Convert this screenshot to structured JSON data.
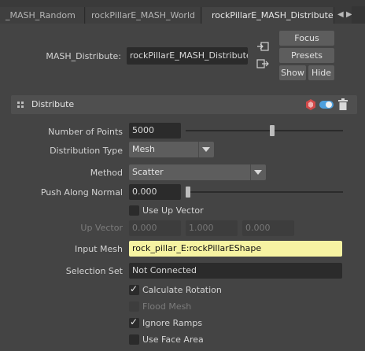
{
  "tabs": [
    {
      "label": "_MASH_Random",
      "active": false
    },
    {
      "label": "rockPillarE_MASH_World",
      "active": false
    },
    {
      "label": "rockPillarE_MASH_Distribute",
      "active": true
    }
  ],
  "header": {
    "node_label": "MASH_Distribute:",
    "node_value": "rockPillarE_MASH_Distribute",
    "focus_label": "Focus",
    "presets_label": "Presets",
    "show_label": "Show",
    "hide_label": "Hide"
  },
  "section": {
    "title": "Distribute",
    "badge_icon": "hexagon-node-icon",
    "toggle_icon": "toggle-on-icon",
    "delete_icon": "trash-icon",
    "accent_color": "#e05050",
    "toggle_color": "#4e9fdc"
  },
  "fields": {
    "number_of_points": {
      "label": "Number of Points",
      "value": "5000",
      "slider_fraction": 0.55
    },
    "distribution_type": {
      "label": "Distribution Type",
      "value": "Mesh"
    },
    "method": {
      "label": "Method",
      "value": "Scatter"
    },
    "push_along_normal": {
      "label": "Push Along Normal",
      "value": "0.000",
      "slider_fraction": 0.0
    },
    "use_up_vector": {
      "label": "Use Up Vector",
      "checked": false
    },
    "up_vector": {
      "label": "Up Vector",
      "x": "0.000",
      "y": "1.000",
      "z": "0.000"
    },
    "input_mesh": {
      "label": "Input Mesh",
      "value": "rock_pillar_E:rockPillarEShape"
    },
    "selection_set": {
      "label": "Selection Set",
      "value": "Not Connected"
    },
    "calculate_rotation": {
      "label": "Calculate Rotation",
      "checked": true
    },
    "flood_mesh": {
      "label": "Flood Mesh",
      "checked": false
    },
    "ignore_ramps": {
      "label": "Ignore Ramps",
      "checked": true
    },
    "use_face_area": {
      "label": "Use Face Area",
      "checked": false
    }
  },
  "glyphs": {
    "check": "✓",
    "tab_left": "◀",
    "tab_right": "▶"
  }
}
